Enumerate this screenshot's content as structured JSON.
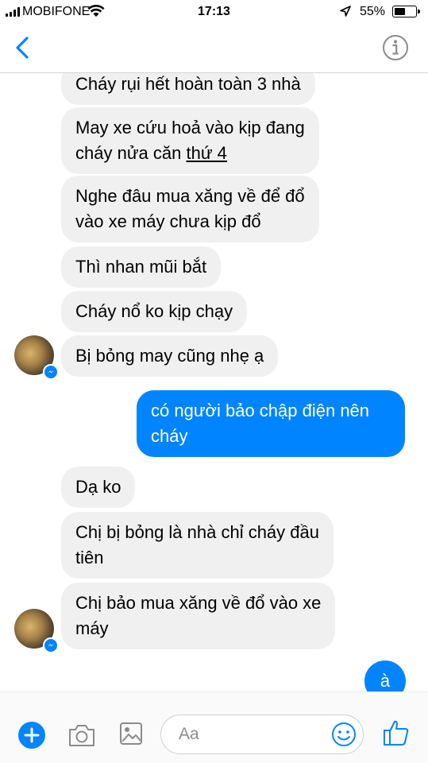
{
  "status_bar": {
    "carrier": "MOBIFONE",
    "time": "17:13",
    "battery_percent": "55%",
    "battery_level": 0.55
  },
  "header": {
    "back_icon": "chevron-left-icon",
    "info_icon": "info-icon"
  },
  "messages": [
    {
      "direction": "incoming",
      "text": "Cháy rụi hết hoàn toàn 3 nhà"
    },
    {
      "direction": "incoming",
      "text_before_link": "May xe cứu hoả vào kịp đang\ncháy nửa căn ",
      "link_text": "thứ 4"
    },
    {
      "direction": "incoming",
      "text": "Nghe đâu mua xăng về để đổ\nvào xe máy chưa kịp đổ"
    },
    {
      "direction": "incoming",
      "text": "Thì nhan mũi bắt"
    },
    {
      "direction": "incoming",
      "text": "Cháy nổ ko kịp chạy"
    },
    {
      "direction": "incoming",
      "text": "Bị bỏng may cũng nhẹ ạ"
    },
    {
      "direction": "outgoing",
      "text": "có người bảo chập điện nên\ncháy"
    },
    {
      "direction": "incoming",
      "text": "Dạ ko"
    },
    {
      "direction": "incoming",
      "text": "Chị bị bỏng là nhà chỉ cháy đầu\ntiên"
    },
    {
      "direction": "incoming",
      "text": "Chị bảo mua xăng về đổ vào xe\nmáy"
    },
    {
      "direction": "outgoing",
      "text": "à"
    }
  ],
  "composer": {
    "placeholder": "Aa",
    "icons": [
      "plus-icon",
      "camera-icon",
      "photo-icon",
      "emoji-icon",
      "thumbs-up-icon"
    ]
  },
  "colors": {
    "accent": "#0084ff",
    "incoming_bubble": "#f1f0f0",
    "outgoing_text": "#ffffff"
  }
}
